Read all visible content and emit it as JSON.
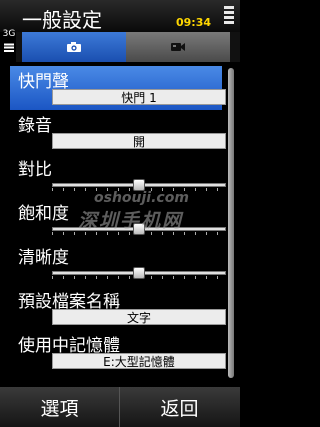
{
  "title_bar": {
    "title": "一般設定",
    "network": "3G",
    "clock": "09:34"
  },
  "tabs": [
    {
      "name": "camera-tab",
      "icon": "camera-icon",
      "active": true
    },
    {
      "name": "video-tab",
      "icon": "video-camera-icon",
      "active": false
    }
  ],
  "settings": {
    "shutter_sound": {
      "label": "快門聲",
      "value": "快門 1"
    },
    "recording": {
      "label": "錄音",
      "value": "開"
    },
    "contrast": {
      "label": "對比",
      "level": 0.5
    },
    "saturation": {
      "label": "飽和度",
      "level": 0.5
    },
    "sharpness": {
      "label": "清晰度",
      "level": 0.5
    },
    "default_filename": {
      "label": "預設檔案名稱",
      "value": "文字"
    },
    "memory_in_use": {
      "label": "使用中記憶體",
      "value": "E:大型記憶體"
    }
  },
  "softkeys": {
    "left": "選項",
    "right": "返回"
  },
  "watermark": {
    "line1": "oshouji.com",
    "line2": "深圳手机网"
  },
  "colors": {
    "accent": "#2a66cc",
    "clock": "#ffd700"
  }
}
